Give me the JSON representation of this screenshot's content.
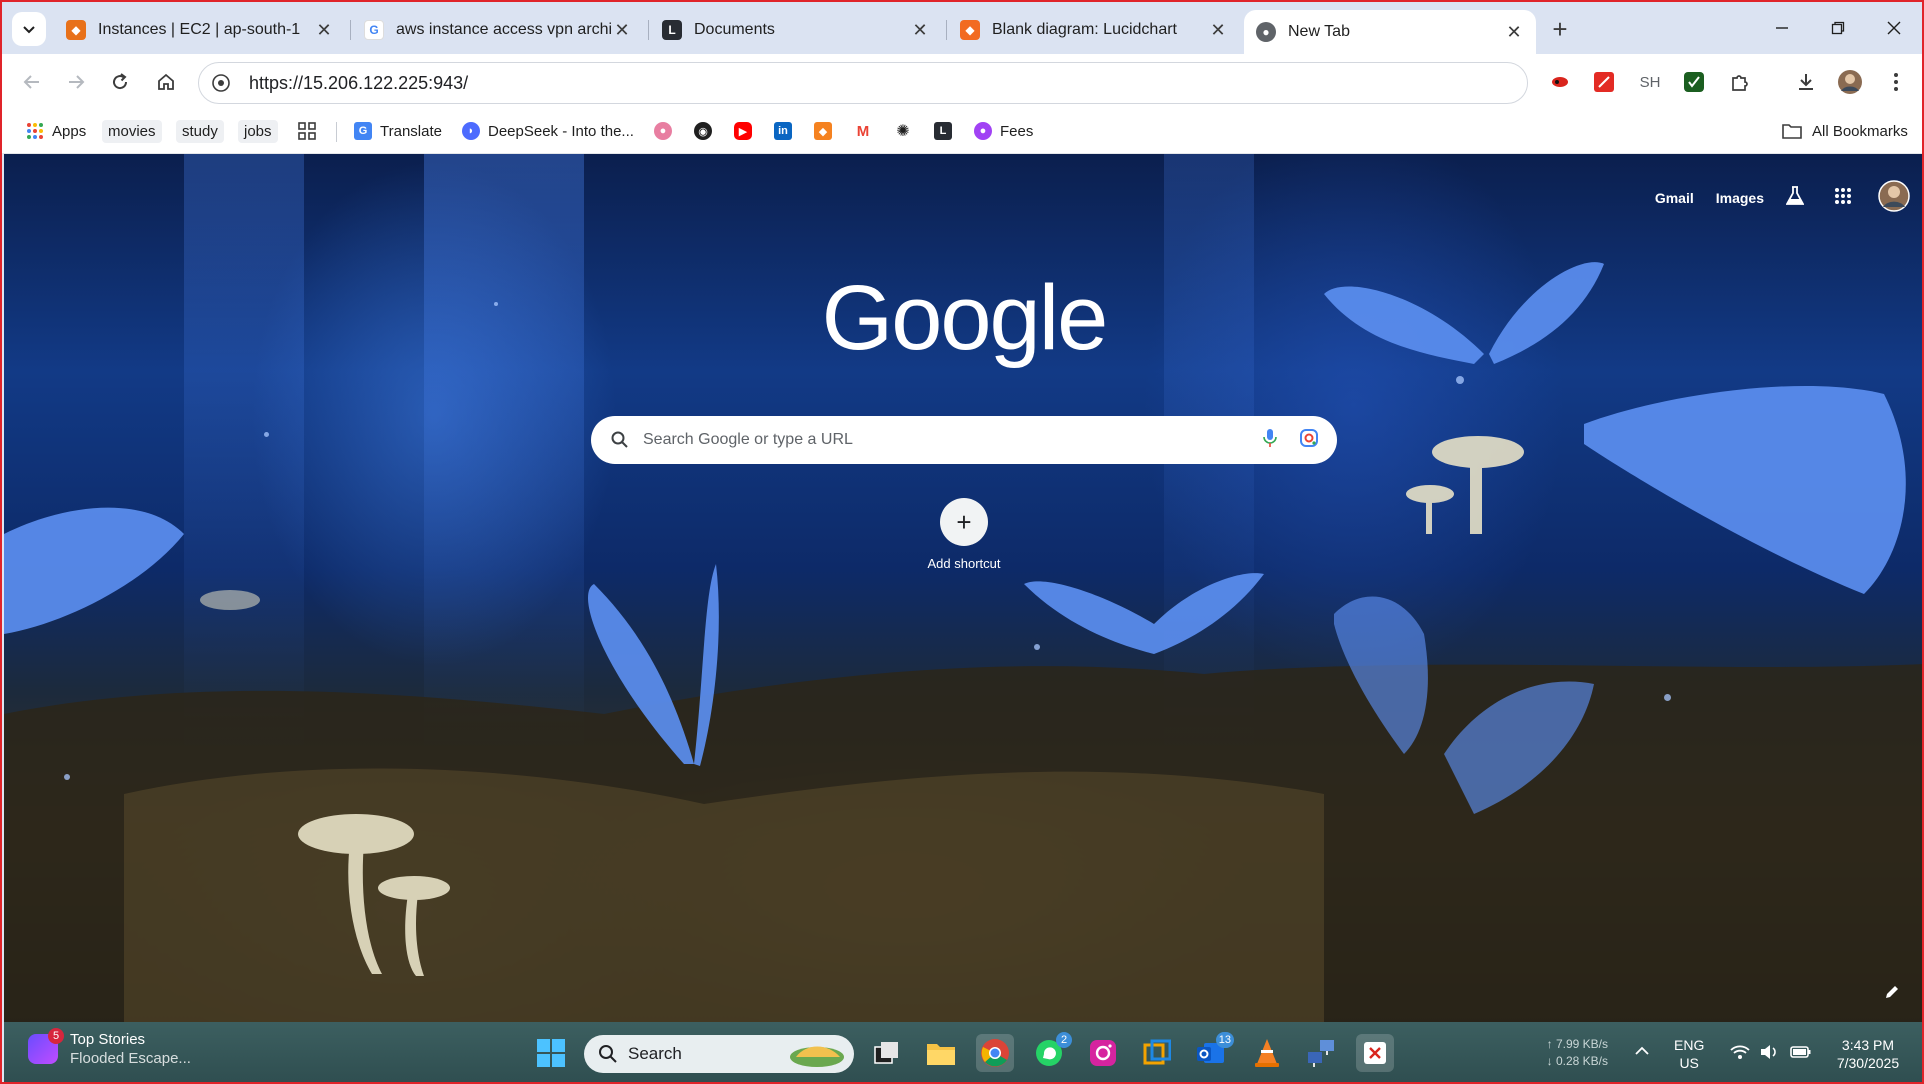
{
  "browser": {
    "tabs": [
      {
        "title": "Instances | EC2 | ap-south-1",
        "icon": "aws-icon",
        "color": "#e8711a"
      },
      {
        "title": "aws instance access vpn archite",
        "icon": "google-icon",
        "color": "#4285f4"
      },
      {
        "title": "Documents",
        "icon": "lucid-icon",
        "color": "#282c33"
      },
      {
        "title": "Blank diagram: Lucidchart",
        "icon": "lucidchart-icon",
        "color": "#f26b21"
      },
      {
        "title": "New Tab",
        "icon": "chrome-icon",
        "color": "#5f6368"
      }
    ],
    "active_tab_index": 4,
    "url": "https://15.206.122.225:943/",
    "toolbar_extensions": [
      {
        "name": "extension-red-icon",
        "color": "#d9251d"
      },
      {
        "name": "extension-pdf-icon",
        "color": "#e32b24"
      },
      {
        "label": "SH"
      },
      {
        "name": "extension-green-icon",
        "color": "#1b5e20"
      },
      {
        "name": "extensions-puzzle-icon"
      },
      {
        "name": "download-icon"
      },
      {
        "name": "profile-avatar"
      },
      {
        "name": "menu-dots-icon"
      }
    ]
  },
  "bookmarks": {
    "apps_label": "Apps",
    "folders": [
      "movies",
      "study",
      "jobs"
    ],
    "items": [
      {
        "label": "Translate",
        "color": "#4285f4"
      },
      {
        "label": "DeepSeek - Into the...",
        "color": "#4d6bfe"
      },
      {
        "label": "Fees",
        "color": "#a142f4"
      }
    ],
    "icon_items": [
      "bookmark-pink-icon",
      "github-icon",
      "youtube-icon",
      "linkedin-icon",
      "box-icon",
      "gmail-icon",
      "chatgpt-icon",
      "lucid-icon"
    ],
    "all_bookmarks": "All Bookmarks"
  },
  "ntp": {
    "links": [
      "Gmail",
      "Images"
    ],
    "logo": "Google",
    "search_placeholder": "Search Google or type a URL",
    "shortcut_label": "Add shortcut"
  },
  "taskbar": {
    "news_title": "Top Stories",
    "news_sub": "Flooded Escape...",
    "news_badge": "5",
    "search_label": "Search",
    "whatsapp_badge": "2",
    "outlook_badge": "13",
    "net_up": "↑ 7.99 KB/s",
    "net_down": "↓ 0.28 KB/s",
    "lang_1": "ENG",
    "lang_2": "US",
    "time": "3:43 PM",
    "date": "7/30/2025"
  }
}
